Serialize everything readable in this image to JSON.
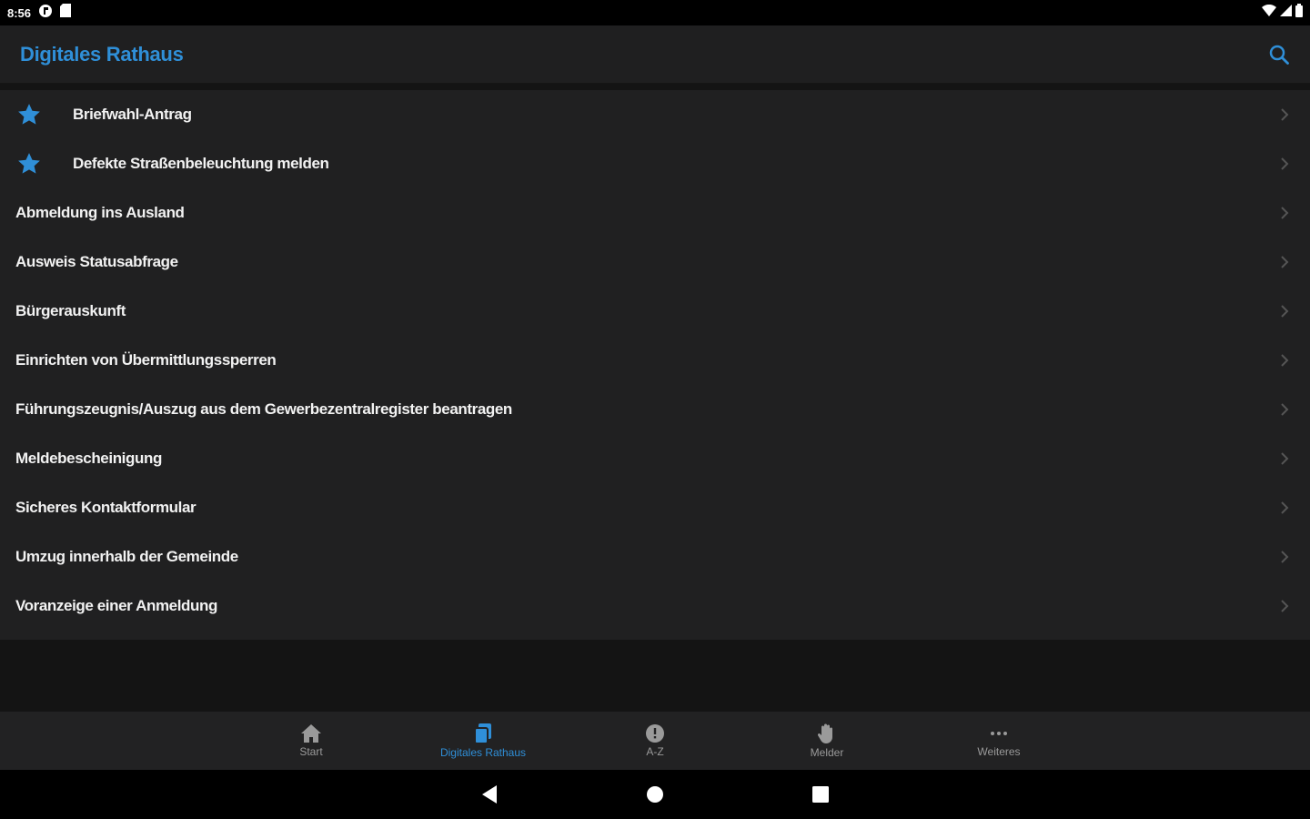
{
  "status_bar": {
    "time": "8:56",
    "icons": [
      "notification-icon",
      "sd-card-icon",
      "wifi-icon",
      "signal-icon",
      "battery-icon"
    ]
  },
  "app_bar": {
    "title": "Digitales Rathaus",
    "search_icon": "search-icon"
  },
  "colors": {
    "accent": "#2f8fd8",
    "background": "#202021",
    "nav_background": "#222223"
  },
  "list": {
    "items": [
      {
        "label": "Briefwahl-Antrag",
        "favorite": true
      },
      {
        "label": "Defekte Straßenbeleuchtung melden",
        "favorite": true
      },
      {
        "label": "Abmeldung ins Ausland",
        "favorite": false
      },
      {
        "label": "Ausweis Statusabfrage",
        "favorite": false
      },
      {
        "label": "Bürgerauskunft",
        "favorite": false
      },
      {
        "label": "Einrichten von Übermittlungssperren",
        "favorite": false
      },
      {
        "label": "Führungszeugnis/Auszug aus dem Gewerbezentralregister beantragen",
        "favorite": false
      },
      {
        "label": "Meldebescheinigung",
        "favorite": false
      },
      {
        "label": "Sicheres Kontaktformular",
        "favorite": false
      },
      {
        "label": "Umzug innerhalb der Gemeinde",
        "favorite": false
      },
      {
        "label": "Voranzeige einer Anmeldung",
        "favorite": false
      }
    ]
  },
  "bottom_nav": {
    "items": [
      {
        "label": "Start",
        "icon": "home-icon",
        "active": false
      },
      {
        "label": "Digitales Rathaus",
        "icon": "documents-icon",
        "active": true
      },
      {
        "label": "A-Z",
        "icon": "info-icon",
        "active": false
      },
      {
        "label": "Melder",
        "icon": "hand-icon",
        "active": false
      },
      {
        "label": "Weiteres",
        "icon": "more-icon",
        "active": false
      }
    ]
  },
  "system_nav": {
    "buttons": [
      "back-icon",
      "home-circle-icon",
      "recents-icon"
    ]
  }
}
